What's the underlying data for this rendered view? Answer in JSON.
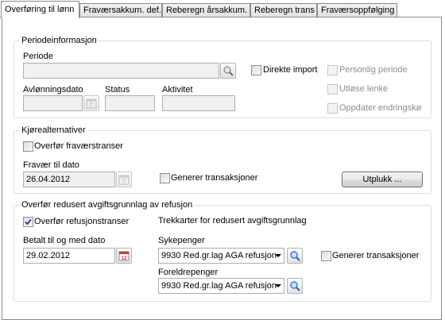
{
  "tabs": [
    {
      "label": "Overføring til lønn",
      "active": true
    },
    {
      "label": "Fraværsakkum. def.",
      "active": false
    },
    {
      "label": "Reberegn årsakkum.",
      "active": false
    },
    {
      "label": "Reberegn trans",
      "active": false
    },
    {
      "label": "Fraværsoppfølging",
      "active": false
    }
  ],
  "periode": {
    "group_title": "Periodeinformasjon",
    "periode_label": "Periode",
    "periode_value": "",
    "avlonningsdato_label": "Avlønningsdato",
    "avlonningsdato_value": "",
    "status_label": "Status",
    "status_value": "",
    "aktivitet_label": "Aktivitet",
    "aktivitet_value": "",
    "direkte_import_label": "Direkte import",
    "direkte_import_checked": false,
    "personlig_periode_label": "Personlig periode",
    "utlose_lenke_label": "Utløse lenke",
    "oppdater_endringsko_label": "Oppdater endringskø"
  },
  "kjore": {
    "group_title": "Kjørealternativer",
    "overfor_fravaerstranser_label": "Overfør fraværstranser",
    "overfor_fravaerstranser_checked": false,
    "fravaer_til_dato_label": "Fravær til dato",
    "fravaer_til_dato_value": "26.04.2012",
    "generer_transaksjoner_label": "Generer transaksjoner",
    "generer_transaksjoner_checked": false,
    "utplukk_button": "Utplukk ..."
  },
  "refusjon": {
    "group_title": "Overfør redusert avgiftsgrunnlag av refusjon",
    "overfor_refusjonstranser_label": "Overfør refusjonstranser",
    "overfor_refusjonstranser_checked": true,
    "trekkarter_label": "Trekkarter for redusert avgiftsgrunnlag",
    "betalt_label": "Betalt til og med dato",
    "betalt_value": "29.02.2012",
    "sykepenger_label": "Sykepenger",
    "sykepenger_value": "9930 Red.gr.lag AGA refusjon",
    "generer_transaksjoner_label": "Generer transaksjoner",
    "generer_transaksjoner_checked": false,
    "foreldrepenger_label": "Foreldrepenger",
    "foreldrepenger_value": "9930 Red.gr.lag AGA refusjon"
  },
  "icons": {
    "calendar_day": "12"
  },
  "colors": {
    "group_border": "#d5dfe5",
    "disabled_field": "#f0f0f0",
    "search_icon_blue": "#3a78c9",
    "calendar_red": "#d9372b"
  }
}
